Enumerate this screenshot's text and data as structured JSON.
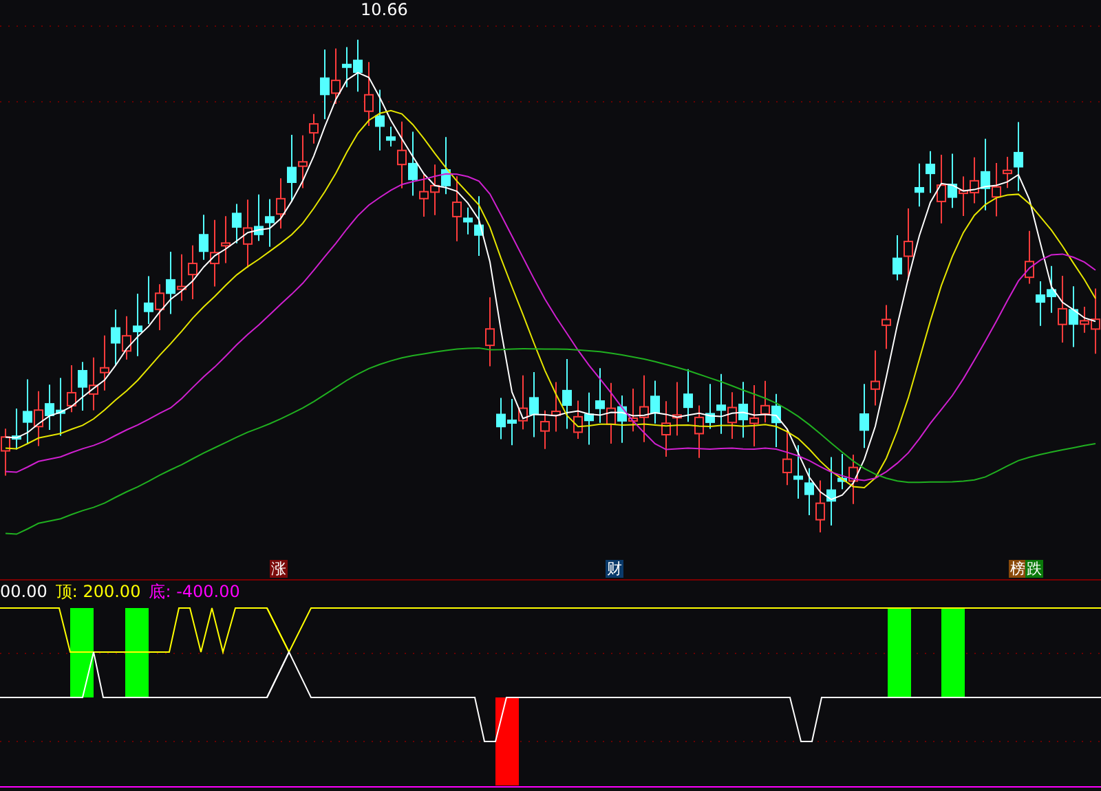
{
  "main_chart": {
    "high_label": "10.66"
  },
  "event_markers": [
    {
      "text": "涨",
      "color": "#7a0a0a"
    },
    {
      "text": "财",
      "color": "#0a3a6a"
    },
    {
      "text": "榜",
      "color": "#8a4a0a"
    },
    {
      "text": "跌",
      "color": "#0a7a0a"
    }
  ],
  "indicator": {
    "legend": [
      {
        "text": "00.00",
        "color": "#ffffff"
      },
      {
        "text": "顶: 200.00",
        "color": "#ffff00"
      },
      {
        "text": "底: -400.00",
        "color": "#ff00ff"
      }
    ]
  }
}
